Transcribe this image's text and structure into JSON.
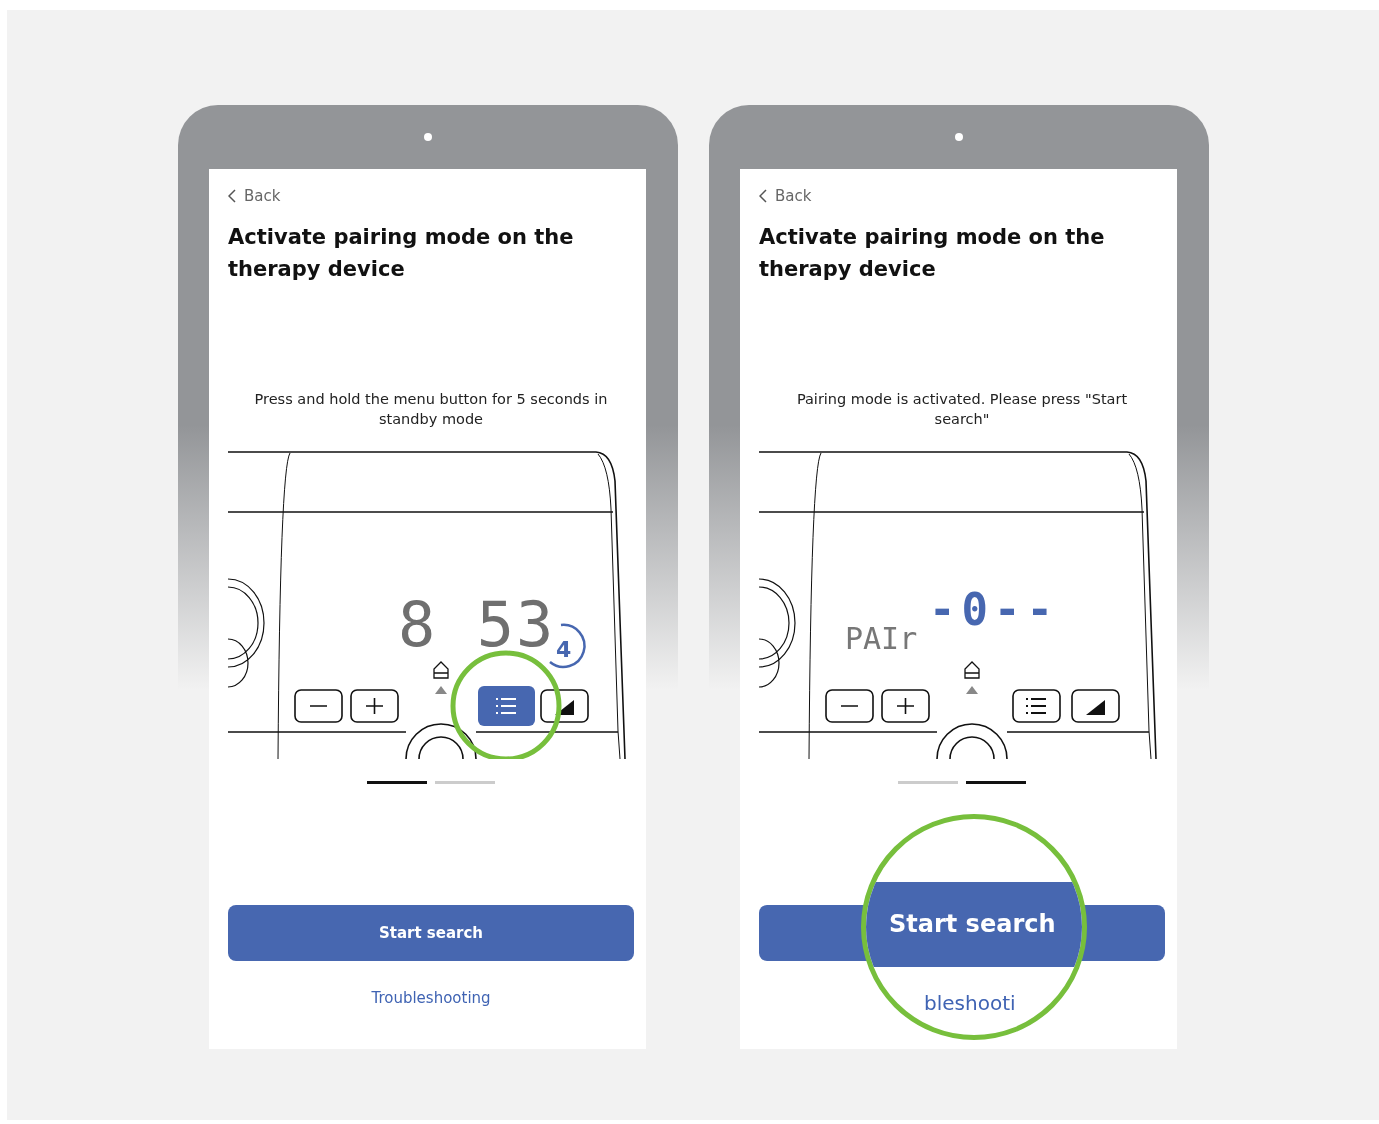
{
  "panels": [
    {
      "back": "Back",
      "title": "Activate pairing mode on the therapy device",
      "instruction": "Press and hold the menu button for 5 seconds in standby mode",
      "display": {
        "kind": "clock",
        "digits": "8 53",
        "countdown": "4"
      },
      "menu_key_highlighted": true,
      "pager": [
        {
          "selected": true
        },
        {
          "selected": false
        }
      ],
      "start_button": "Start search",
      "link": "Troubleshooting"
    },
    {
      "back": "Back",
      "title": "Activate pairing mode on the therapy device",
      "instruction": "Pairing mode is activated. Please press \"Start search\"",
      "display": {
        "kind": "pairing",
        "label": "PAIr",
        "code": "-0--"
      },
      "menu_key_highlighted": false,
      "pager": [
        {
          "selected": false
        },
        {
          "selected": true
        }
      ],
      "magnifier": {
        "button_label": "Start search",
        "link_label": "bleshooti"
      }
    }
  ]
}
